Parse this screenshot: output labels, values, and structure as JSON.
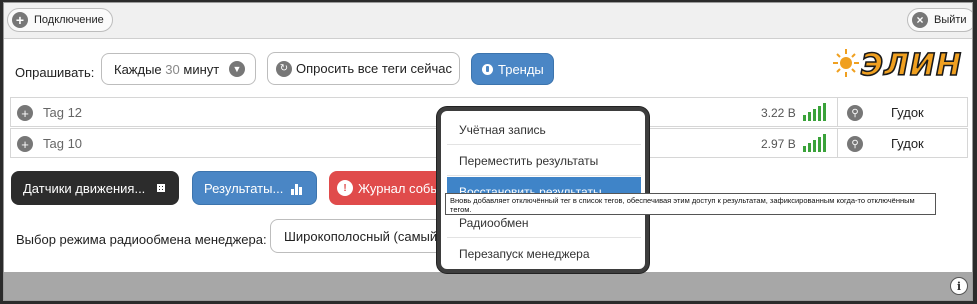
{
  "topbar": {
    "connect_label": "Подключение",
    "logout_label": "Выйти"
  },
  "poll": {
    "label": "Опрашивать:",
    "interval_prefix": "Каждые",
    "interval_value": "30",
    "interval_suffix": "минут",
    "poll_all_label": "Опросить все теги сейчас",
    "trends_label": "Тренды"
  },
  "logo": {
    "text": "ЭЛИН"
  },
  "tags": [
    {
      "name": "Tag 12",
      "voltage": "3.22 В",
      "action": "Гудок"
    },
    {
      "name": "Tag 10",
      "voltage": "2.97 В",
      "action": "Гудок"
    }
  ],
  "buttons": {
    "motion": "Датчики движения...",
    "results": "Результаты...",
    "journal": "Журнал собы"
  },
  "radio": {
    "label": "Выбор режима радиообмена менеджера:",
    "value": "Широкополосный (самый"
  },
  "menu": {
    "items": [
      "Учётная запись",
      "Переместить результаты",
      "Восстановить результаты",
      "Радиообмен",
      "Перезапуск менеджера"
    ]
  },
  "tooltip": {
    "text": "Вновь добавляет отключённый тег в список тегов, обеспечивая этим доступ к результатам, зафиксированным когда-то отключённым тегом."
  },
  "colors": {
    "accent_blue": "#4a86c5",
    "signal_green": "#3aa23a",
    "journal_red": "#e04b4b",
    "logo_orange": "#f0a020"
  }
}
